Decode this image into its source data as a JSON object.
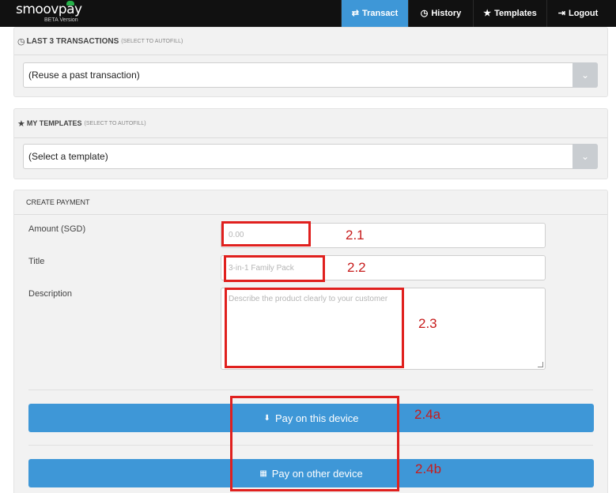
{
  "brand": {
    "name_part1": "smoov",
    "name_part2": "pay",
    "subtitle": "BETA Version",
    "cloud_color": "#27b24a"
  },
  "nav": {
    "items": [
      {
        "label": "Transact",
        "icon": "arrows-exchange-icon",
        "glyph": "⇄",
        "active": true
      },
      {
        "label": "History",
        "icon": "clock-icon",
        "glyph": "◷",
        "active": false
      },
      {
        "label": "Templates",
        "icon": "star-icon",
        "glyph": "★",
        "active": false
      },
      {
        "label": "Logout",
        "icon": "logout-icon",
        "glyph": "⇥",
        "active": false
      }
    ],
    "active_color": "#3e97d7"
  },
  "transactions": {
    "title": "LAST 3 TRANSACTIONS",
    "hint": "(SELECT TO AUTOFILL)",
    "selected": "(Reuse a past transaction)"
  },
  "templates": {
    "title": "MY TEMPLATES",
    "hint": "(SELECT TO AUTOFILL)",
    "selected": "(Select a template)"
  },
  "payment": {
    "title": "CREATE PAYMENT",
    "amount_label": "Amount (SGD)",
    "amount_placeholder": "0.00",
    "title_label": "Title",
    "title_placeholder": "3-in-1 Family Pack",
    "description_label": "Description",
    "description_placeholder": "Describe the product clearly to your customer",
    "pay_here_label": "Pay on this device",
    "pay_other_label": "Pay on other device"
  },
  "annotations": [
    "2.1",
    "2.2",
    "2.3",
    "2.4a",
    "2.4b"
  ],
  "colors": {
    "accent": "#3e97d7",
    "annotation_red": "#e0201e"
  }
}
